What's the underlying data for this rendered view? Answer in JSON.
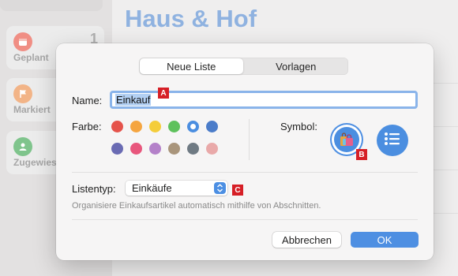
{
  "background": {
    "title": "Haus & Hof",
    "smart_lists": [
      {
        "label": "Geplant",
        "count": "1",
        "icon": "calendar-icon",
        "color": "#f08e84"
      },
      {
        "label": "Markiert",
        "count": "",
        "icon": "flag-icon",
        "color": "#f2b487"
      },
      {
        "label": "Zugewies",
        "count": "",
        "icon": "person-icon",
        "color": "#7fc48c"
      }
    ]
  },
  "dialog": {
    "tabs": [
      "Neue Liste",
      "Vorlagen"
    ],
    "active_tab": "Neue Liste",
    "name_label": "Name:",
    "name_value": "Einkauf",
    "color_label": "Farbe:",
    "colors": [
      "#e5534b",
      "#f5a540",
      "#f4cd3a",
      "#5ec15c",
      "#4b8ee0",
      "#4b7cc9",
      "#6a6bb3",
      "#e8567c",
      "#b481c9",
      "#a9957b",
      "#6f7a83",
      "#e9a9a9"
    ],
    "selected_color": "#4b8ee0",
    "symbol_label": "Symbol:",
    "symbols": [
      "shopping-bags-icon",
      "list-icon"
    ],
    "list_type_label": "Listentyp:",
    "list_type_value": "Einkäufe",
    "hint": "Organisiere Einkaufsartikel automatisch mithilfe von Abschnitten.",
    "cancel_label": "Abbrechen",
    "ok_label": "OK"
  },
  "annotations": [
    "A",
    "B",
    "C"
  ]
}
